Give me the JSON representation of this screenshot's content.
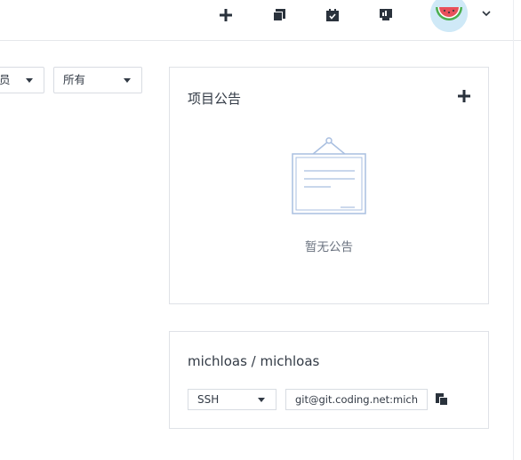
{
  "topnav": {
    "items": [
      {
        "icon": "plus-icon"
      },
      {
        "icon": "copy-stack-icon"
      },
      {
        "icon": "calendar-check-icon"
      },
      {
        "icon": "presentation-board-icon"
      }
    ],
    "avatar": {
      "icon": "watermelon-avatar-icon"
    },
    "dropdown_icon": "chevron-down-icon"
  },
  "filters": {
    "member_select": {
      "value": "员"
    },
    "status_select": {
      "value": "所有"
    }
  },
  "announcement": {
    "title": "项目公告",
    "add_icon": "plus-icon",
    "empty_illustration": "empty-board-illustration",
    "empty_text": "暂无公告"
  },
  "repo": {
    "title": "michloas / michloas",
    "protocol_select": {
      "value": "SSH"
    },
    "clone_url": {
      "value": "git@git.coding.net:michloas/michloas.git"
    },
    "copy_icon": "copy-icon"
  },
  "colors": {
    "text": "#323a45",
    "muted": "#6b7380",
    "border": "#dfe2e7",
    "illustration_line": "#a9bfe0",
    "avatar_bg": "#cfe9f7",
    "watermelon_red": "#e8505b",
    "watermelon_green": "#4caf50"
  }
}
